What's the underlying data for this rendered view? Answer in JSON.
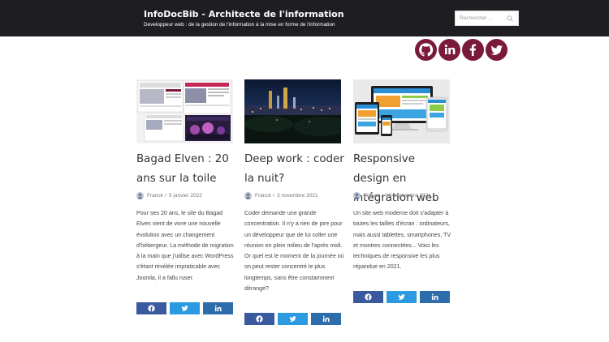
{
  "header": {
    "title": "InfoDocBib - Architecte de l'information",
    "description": "Developpeur web : de la gestion de l'information à la mise en forme de l'information",
    "search_placeholder": "Rechercher ..."
  },
  "social": [
    {
      "name": "github-icon"
    },
    {
      "name": "linkedin-icon"
    },
    {
      "name": "facebook-icon"
    },
    {
      "name": "twitter-icon"
    }
  ],
  "colors": {
    "header_bg": "#1e1e22",
    "social_bg": "#7a1a3a",
    "facebook": "#3a5aa0",
    "twitter": "#2a9be0",
    "linkedin": "#2e6dab"
  },
  "posts": [
    {
      "title": "Bagad Elven : 20 ans sur la toile",
      "author": "Franck",
      "date": "5 janvier 2022",
      "excerpt": "Pour ses 20 ans, le site du Bagad Elven vient de vivre une nouvelle évolution avec un changement d'hébergeur. La méthode de migration à la main que j'utilise avec WordPress s'étant révélée impraticable avec Joomla, il a fallu ruser.",
      "excerpt2": ""
    },
    {
      "title": "Deep work : coder la nuit?",
      "author": "Franck",
      "date": "3 novembre 2021",
      "excerpt": "Coder demande une grande concentration. Il n'y a rien de pire pour un développeur que de lui coller une réunion en plein milieu de l'après midi.",
      "excerpt2": "Or quel est le moment de la journée où on peut rester concentré le plus longtemps, sans être constamment dérangé?"
    },
    {
      "title": "Responsive design en intégration web",
      "author": "Franck",
      "date": "29 septembre 2021",
      "excerpt": "Un site web moderne doit s'adapter à toutes les tailles d'écran : ordinateurs, mais aussi tablettes, smartphones, TV et montres connectées... Voici les techniques de responsive les plus répandue en 2021.",
      "excerpt2": ""
    }
  ],
  "meta_separator": "/"
}
